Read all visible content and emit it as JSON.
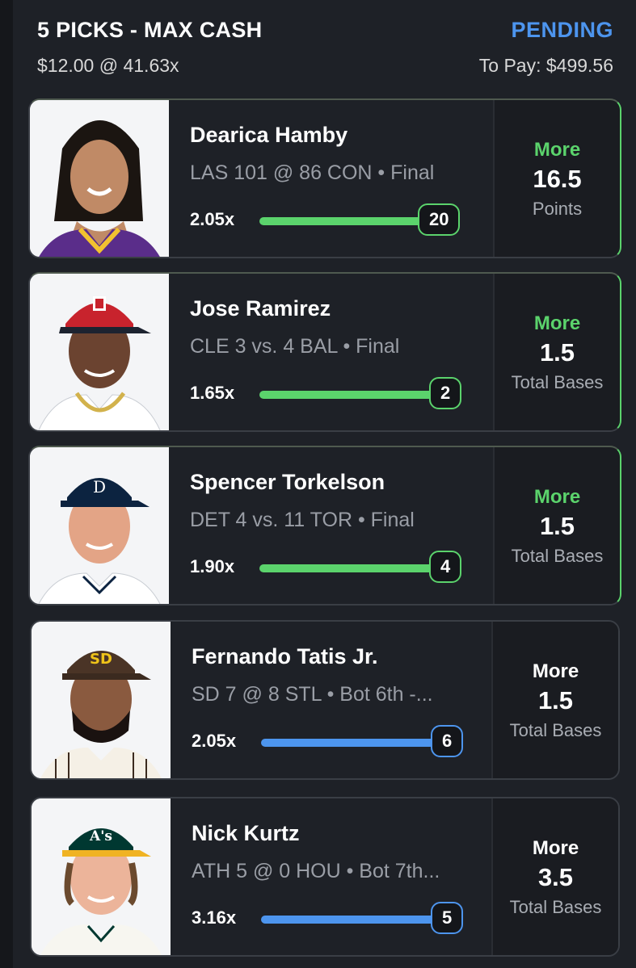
{
  "header": {
    "title": "5 PICKS - MAX CASH",
    "status": "PENDING",
    "stake": "$12.00 @ 41.63x",
    "to_pay": "To Pay: $499.56"
  },
  "picks": [
    {
      "name": "Dearica Hamby",
      "game": "LAS 101 @ 86 CON • Final",
      "multiplier": "2.05x",
      "stat": "20",
      "direction": "More",
      "line": "16.5",
      "stat_type": "Points",
      "progress_color": "#5bd36c"
    },
    {
      "name": "Jose Ramirez",
      "game": "CLE 3 vs. 4 BAL • Final",
      "multiplier": "1.65x",
      "stat": "2",
      "direction": "More",
      "line": "1.5",
      "stat_type": "Total Bases",
      "progress_color": "#5bd36c"
    },
    {
      "name": "Spencer Torkelson",
      "game": "DET 4 vs. 11 TOR • Final",
      "multiplier": "1.90x",
      "stat": "4",
      "direction": "More",
      "line": "1.5",
      "stat_type": "Total Bases",
      "progress_color": "#5bd36c"
    },
    {
      "name": "Fernando Tatis Jr.",
      "game": "SD 7 @ 8 STL • Bot 6th  -...",
      "multiplier": "2.05x",
      "stat": "6",
      "direction": "More",
      "line": "1.5",
      "stat_type": "Total Bases",
      "progress_color": "#4d95ee"
    },
    {
      "name": "Nick Kurtz",
      "game": "ATH 5 @ 0 HOU • Bot 7th...",
      "multiplier": "3.16x",
      "stat": "5",
      "direction": "More",
      "line": "3.5",
      "stat_type": "Total Bases",
      "progress_color": "#4d95ee"
    }
  ],
  "colors": {
    "accent_green": "#5bd36c",
    "accent_blue": "#4d95ee",
    "background": "#1e2127"
  }
}
